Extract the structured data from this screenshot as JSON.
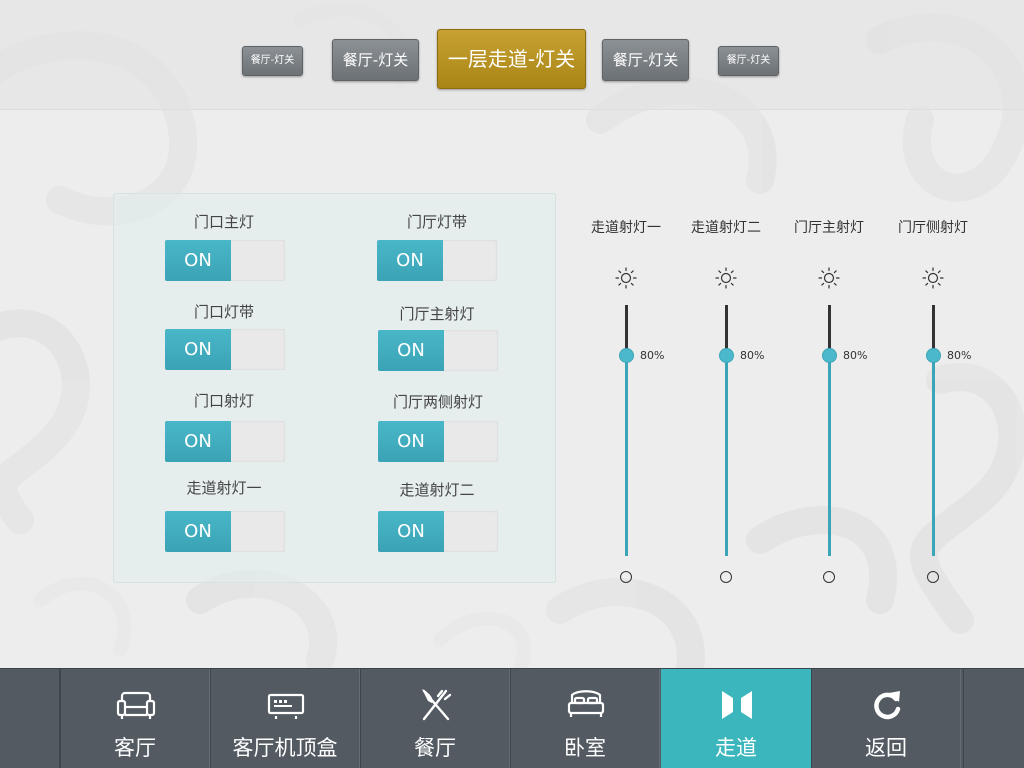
{
  "top_tabs": [
    {
      "label": "餐厅-灯关",
      "size": "small"
    },
    {
      "label": "餐厅-灯关",
      "size": "medium"
    },
    {
      "label": "一层走道-灯关",
      "size": "active"
    },
    {
      "label": "餐厅-灯关",
      "size": "medium"
    },
    {
      "label": "餐厅-灯关",
      "size": "small"
    }
  ],
  "switches": [
    {
      "label": "门口主灯",
      "state": "ON"
    },
    {
      "label": "门厅灯带",
      "state": "ON"
    },
    {
      "label": "门口灯带",
      "state": "ON"
    },
    {
      "label": "门厅主射灯",
      "state": "ON"
    },
    {
      "label": "门口射灯",
      "state": "ON"
    },
    {
      "label": "门厅两侧射灯",
      "state": "ON"
    },
    {
      "label": "走道射灯一",
      "state": "ON"
    },
    {
      "label": "走道射灯二",
      "state": "ON"
    }
  ],
  "dimmers": [
    {
      "label": "走道射灯一",
      "level_text": "80%",
      "level": 0.8
    },
    {
      "label": "走道射灯二",
      "level_text": "80%",
      "level": 0.8
    },
    {
      "label": "门厅主射灯",
      "level_text": "80%",
      "level": 0.8
    },
    {
      "label": "门厅侧射灯",
      "level_text": "80%",
      "level": 0.8
    }
  ],
  "bottom_nav": [
    {
      "label": "客厅",
      "icon": "sofa-icon",
      "active": false
    },
    {
      "label": "客厅机顶盒",
      "icon": "set-top-box-icon",
      "active": false
    },
    {
      "label": "餐厅",
      "icon": "fork-knife-icon",
      "active": false
    },
    {
      "label": "卧室",
      "icon": "bed-icon",
      "active": false
    },
    {
      "label": "走道",
      "icon": "corridor-icon",
      "active": true
    },
    {
      "label": "返回",
      "icon": "refresh-back-icon",
      "active": false
    }
  ],
  "colors": {
    "accent_teal": "#3bb6bd",
    "toggle_on": "#42adc0",
    "active_tab_gold": "#b8921f",
    "nav_bg": "#535a62"
  }
}
